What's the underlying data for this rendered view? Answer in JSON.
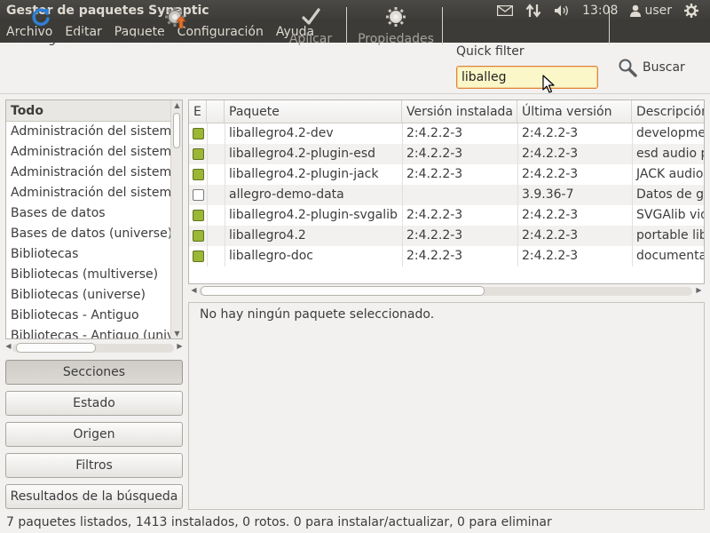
{
  "window": {
    "title": "Gestor de paquetes Synaptic"
  },
  "tray": {
    "clock": "13:08",
    "user": "user"
  },
  "menu": [
    "Archivo",
    "Editar",
    "Paquete",
    "Configuración",
    "Ayuda"
  ],
  "toolbar": {
    "reload": "Recargar",
    "mark_all": "Marcar todas las actualizaciones",
    "apply": "Aplicar",
    "properties": "Propiedades",
    "quick_filter_label": "Quick filter",
    "quick_filter_value": "liballeg",
    "search": "Buscar"
  },
  "sections": {
    "header": "Todo",
    "items": [
      "Administración del sistema",
      "Administración del sistema",
      "Administración del sistema",
      "Administración del sistema",
      "Bases de datos",
      "Bases de datos (universe)",
      "Bibliotecas",
      "Bibliotecas (multiverse)",
      "Bibliotecas (universe)",
      "Bibliotecas - Antiguo",
      "Bibliotecas - Antiguo (universe)"
    ]
  },
  "filter_buttons": [
    "Secciones",
    "Estado",
    "Origen",
    "Filtros",
    "Resultados de la búsqueda"
  ],
  "packages": {
    "columns": [
      "E",
      "",
      "Paquete",
      "Versión instalada",
      "Última versión",
      "Descripción"
    ],
    "rows": [
      {
        "installed": true,
        "name": "liballegro4.2-dev",
        "installed_version": "2:4.2.2-3",
        "latest_version": "2:4.2.2-3",
        "description": "development files for the Allegro library"
      },
      {
        "installed": true,
        "name": "liballegro4.2-plugin-esd",
        "installed_version": "2:4.2.2-3",
        "latest_version": "2:4.2.2-3",
        "description": "esd audio plugin for the Allegro library"
      },
      {
        "installed": true,
        "name": "liballegro4.2-plugin-jack",
        "installed_version": "2:4.2.2-3",
        "latest_version": "2:4.2.2-3",
        "description": "JACK audio plugin for the Allegro library"
      },
      {
        "installed": false,
        "name": "allegro-demo-data",
        "installed_version": "",
        "latest_version": "3.9.36-7",
        "description": "Datos de gráficos y sonido del juego de demostración"
      },
      {
        "installed": true,
        "name": "liballegro4.2-plugin-svgalib",
        "installed_version": "2:4.2.2-3",
        "latest_version": "2:4.2.2-3",
        "description": "SVGAlib video plugin for the Allegro library"
      },
      {
        "installed": true,
        "name": "liballegro4.2",
        "installed_version": "2:4.2.2-3",
        "latest_version": "2:4.2.2-3",
        "description": "portable library for cross-platform game development"
      },
      {
        "installed": true,
        "name": "liballegro-doc",
        "installed_version": "2:4.2.2-3",
        "latest_version": "2:4.2.2-3",
        "description": "documentation for the Allegro library"
      }
    ]
  },
  "details": {
    "message": "No hay ningún paquete seleccionado."
  },
  "status": "7 paquetes listados, 1413 instalados, 0 rotos. 0 para instalar/actualizar, 0 para eliminar",
  "colors": {
    "installed_checkbox": "#9bb735",
    "quick_filter_bg": "#fbf7c8",
    "focus": "#e0843b"
  }
}
